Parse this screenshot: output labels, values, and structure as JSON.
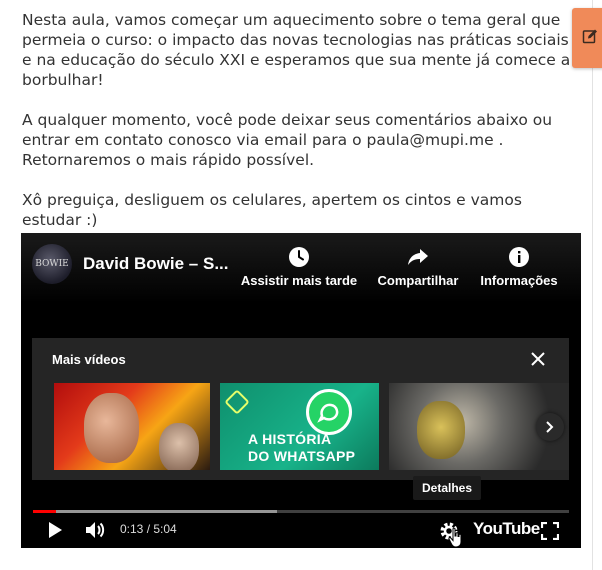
{
  "article": {
    "paragraph1": "Nesta aula, vamos começar um aquecimento sobre o tema geral que permeia o curso: o impacto das novas tecnologias nas práticas sociais e na educação do século XXI e esperamos que sua mente já comece a borbulhar!",
    "paragraph2": "A qualquer momento, você pode deixar seus comentários abaixo ou entrar em contato conosco via email para o paula@mupi.me . Retornaremos o mais rápido possível.",
    "paragraph3": "Xô preguiça, desliguem os celulares, apertem os cintos e vamos estudar :)"
  },
  "edit_tab": {
    "icon": "pencil-edit-icon",
    "color": "#f08a59"
  },
  "video": {
    "channel_avatar_text": "BOWIE",
    "title": "David Bowie – S...",
    "actions": [
      {
        "label": "Assistir mais tarde",
        "icon": "clock-icon"
      },
      {
        "label": "Compartilhar",
        "icon": "share-arrow-icon"
      },
      {
        "label": "Informações",
        "icon": "info-icon"
      }
    ],
    "more_videos": {
      "title": "Mais vídeos",
      "thumbnails": [
        {
          "caption": ""
        },
        {
          "caption": "A HISTÓRIA DO WHATSAPP"
        },
        {
          "caption": ""
        }
      ]
    },
    "tooltip": "Detalhes",
    "time": "0:13 / 5:04",
    "progress": {
      "played_fraction": 0.043,
      "buffered_fraction": 0.455
    },
    "logo_text": "YouTube",
    "accent_color": "#ff0000"
  }
}
